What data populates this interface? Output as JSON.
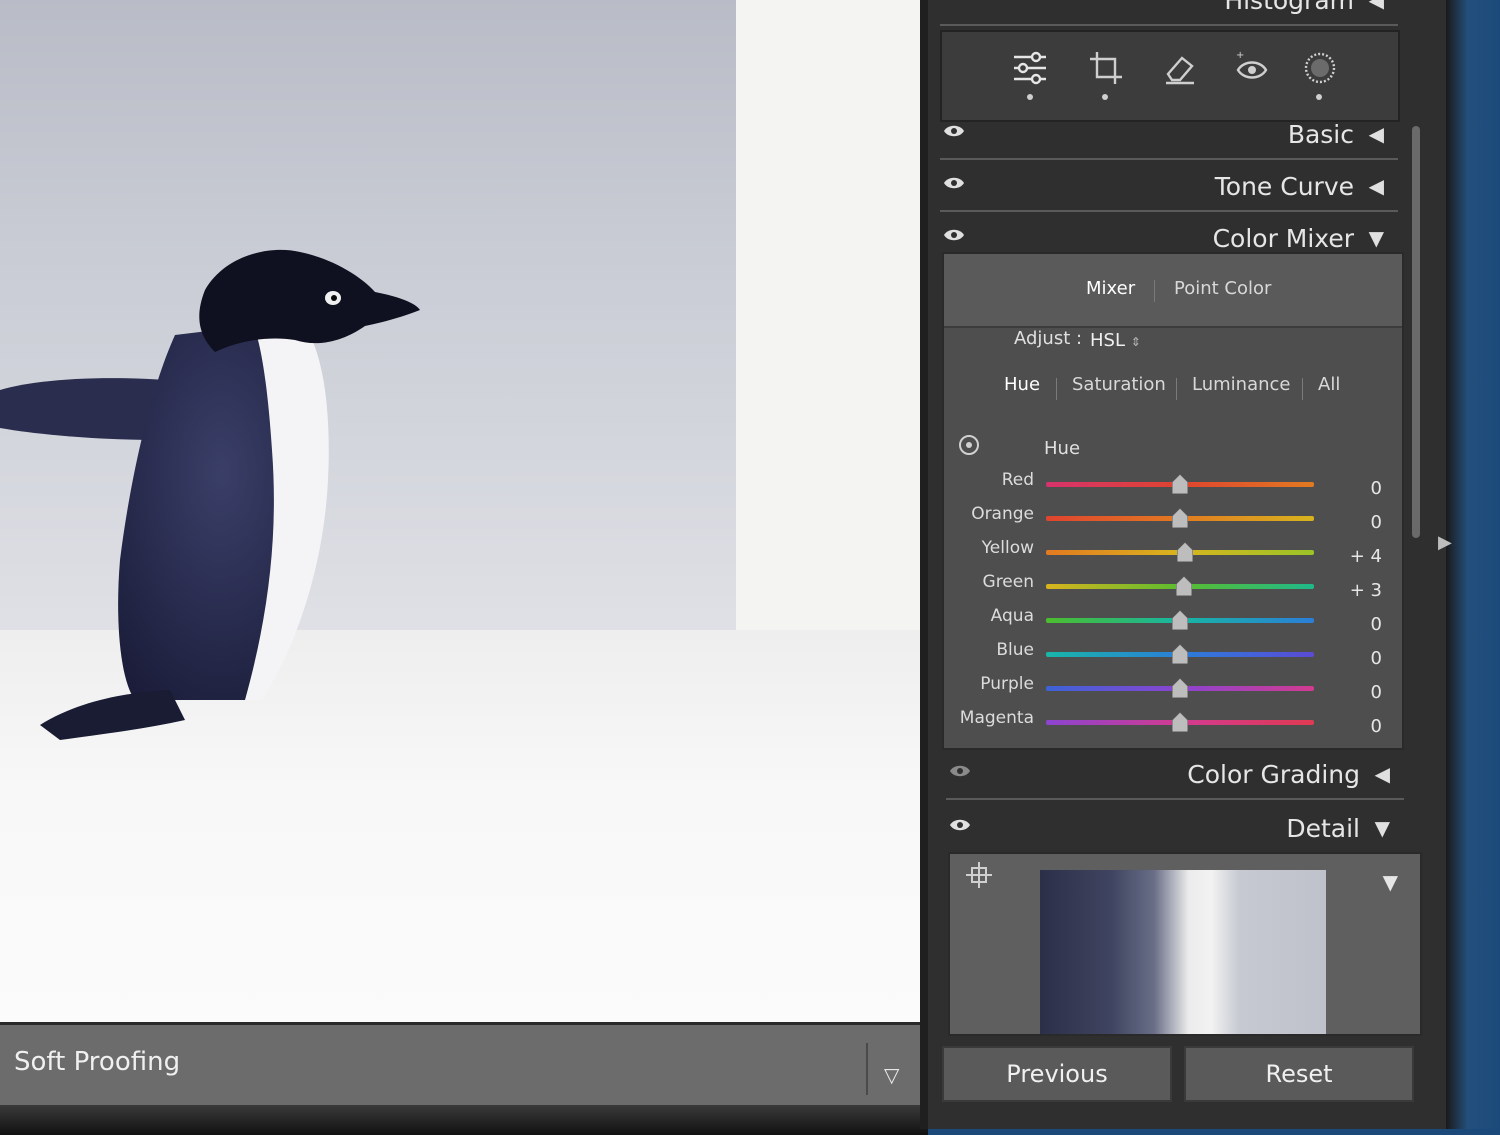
{
  "panel": {
    "histogram_title": "Histogram",
    "sections": {
      "basic": "Basic",
      "tone_curve": "Tone Curve",
      "color_mixer": "Color Mixer",
      "color_grading": "Color Grading",
      "detail": "Detail"
    },
    "tools": [
      "sliders-icon",
      "crop-icon",
      "eraser-icon",
      "red-eye-icon",
      "masking-icon"
    ],
    "mixer": {
      "tabs": {
        "mixer": "Mixer",
        "point_color": "Point Color"
      },
      "adjust_label": "Adjust :",
      "adjust_value": "HSL",
      "subtabs": [
        "Hue",
        "Saturation",
        "Luminance",
        "All"
      ],
      "active_subtab": "Hue",
      "heading": "Hue",
      "rows": [
        {
          "label": "Red",
          "value": "0",
          "level": 0
        },
        {
          "label": "Orange",
          "value": "0",
          "level": 0
        },
        {
          "label": "Yellow",
          "value": "+ 4",
          "level": 4
        },
        {
          "label": "Green",
          "value": "+ 3",
          "level": 3
        },
        {
          "label": "Aqua",
          "value": "0",
          "level": 0
        },
        {
          "label": "Blue",
          "value": "0",
          "level": 0
        },
        {
          "label": "Purple",
          "value": "0",
          "level": 0
        },
        {
          "label": "Magenta",
          "value": "0",
          "level": 0
        }
      ]
    },
    "buttons": {
      "previous": "Previous",
      "reset": "Reset"
    }
  },
  "bottom_bar": {
    "soft_proofing": "Soft Proofing"
  },
  "colors": {
    "panel_bg": "#2f2f2f",
    "text": "#e6e6e6",
    "desktop_accent": "#1b4a7a"
  }
}
